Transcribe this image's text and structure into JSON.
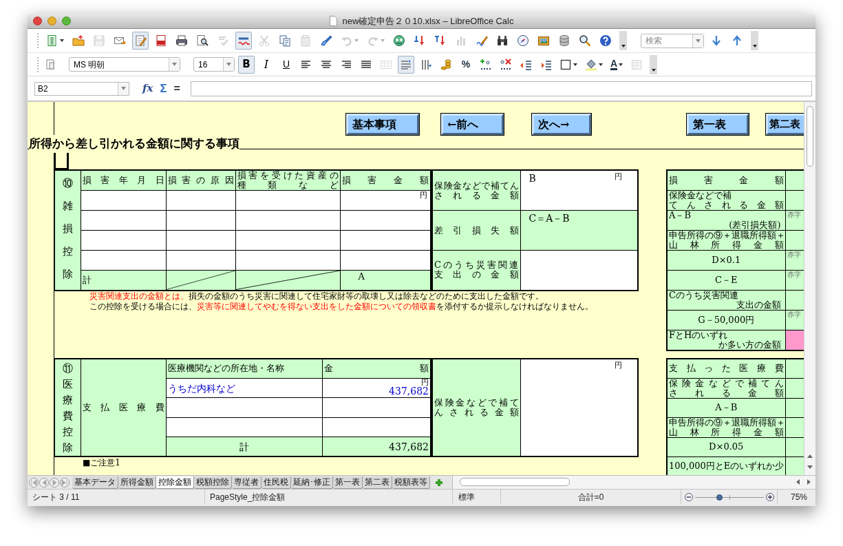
{
  "window": {
    "title": "new確定申告２０10.xlsx – LibreOffice Calc"
  },
  "toolbars": [
    {
      "items": [
        {
          "kind": "new",
          "pressed": false,
          "disabled": false
        },
        {
          "kind": "open",
          "pressed": false,
          "disabled": false
        },
        {
          "kind": "save",
          "pressed": false,
          "disabled": true
        },
        {
          "kind": "mail",
          "pressed": false,
          "disabled": false
        },
        {
          "kind": "edit",
          "pressed": true,
          "disabled": false
        },
        {
          "kind": "pdf",
          "pressed": false,
          "disabled": false
        },
        {
          "kind": "print",
          "pressed": false,
          "disabled": false
        },
        {
          "kind": "preview",
          "pressed": false,
          "disabled": false
        },
        {
          "kind": "spell",
          "pressed": false,
          "disabled": true
        },
        {
          "kind": "autospell",
          "pressed": true,
          "disabled": false
        },
        {
          "kind": "cut",
          "pressed": false,
          "disabled": true
        },
        {
          "kind": "copy",
          "pressed": false,
          "disabled": false
        },
        {
          "kind": "paste",
          "pressed": false,
          "disabled": true
        },
        {
          "kind": "clone",
          "pressed": false,
          "disabled": false
        },
        {
          "kind": "undo",
          "pressed": false,
          "disabled": true
        },
        {
          "kind": "redo",
          "pressed": false,
          "disabled": true
        },
        {
          "kind": "navigator",
          "pressed": false,
          "disabled": false
        },
        {
          "kind": "sort-asc",
          "pressed": false,
          "disabled": false
        },
        {
          "kind": "sort-desc",
          "pressed": false,
          "disabled": false
        },
        {
          "kind": "chart",
          "pressed": false,
          "disabled": true
        },
        {
          "kind": "draw",
          "pressed": false,
          "disabled": false
        },
        {
          "kind": "find",
          "pressed": false,
          "disabled": false
        },
        {
          "kind": "compass",
          "pressed": false,
          "disabled": false
        },
        {
          "kind": "gallery",
          "pressed": false,
          "disabled": false
        },
        {
          "kind": "database",
          "pressed": false,
          "disabled": false
        },
        {
          "kind": "zoom",
          "pressed": false,
          "disabled": false
        },
        {
          "kind": "help",
          "pressed": false,
          "disabled": false
        },
        {
          "kind": "more"
        },
        {
          "kind": "search-field",
          "placeholder": "検索"
        },
        {
          "kind": "down",
          "pressed": false,
          "disabled": false
        },
        {
          "kind": "up",
          "pressed": false,
          "disabled": false
        },
        {
          "kind": "more"
        }
      ]
    },
    {
      "items": [
        {
          "kind": "styles",
          "pressed": false,
          "disabled": false
        },
        {
          "kind": "font-name",
          "value": "MS 明朝"
        },
        {
          "kind": "font-size",
          "value": "16"
        },
        {
          "kind": "bold",
          "label": "B",
          "pressed": true,
          "disabled": false
        },
        {
          "kind": "italic",
          "label": "I",
          "pressed": false,
          "disabled": false
        },
        {
          "kind": "underline",
          "label": "U",
          "pressed": false,
          "disabled": false
        },
        {
          "kind": "align-left",
          "pressed": false,
          "disabled": false
        },
        {
          "kind": "align-center",
          "pressed": false,
          "disabled": false
        },
        {
          "kind": "align-right",
          "pressed": false,
          "disabled": false
        },
        {
          "kind": "justify",
          "pressed": false,
          "disabled": false
        },
        {
          "kind": "merge",
          "pressed": false,
          "disabled": true
        },
        {
          "kind": "wrap",
          "pressed": true,
          "disabled": false
        },
        {
          "kind": "vertical",
          "pressed": false,
          "disabled": false
        },
        {
          "kind": "currency",
          "pressed": false,
          "disabled": false
        },
        {
          "kind": "percent",
          "label": "%",
          "pressed": false,
          "disabled": false
        },
        {
          "kind": "add-decimal",
          "pressed": false,
          "disabled": false
        },
        {
          "kind": "del-decimal",
          "pressed": false,
          "disabled": false
        },
        {
          "kind": "outdent",
          "pressed": false,
          "disabled": false
        },
        {
          "kind": "indent",
          "pressed": false,
          "disabled": false
        },
        {
          "kind": "border",
          "pressed": false,
          "disabled": false
        },
        {
          "kind": "bg-color",
          "pressed": false,
          "disabled": false
        },
        {
          "kind": "font-color",
          "label": "A",
          "pressed": false,
          "disabled": false
        },
        {
          "kind": "grid",
          "pressed": false,
          "disabled": true
        },
        {
          "kind": "more"
        }
      ]
    }
  ],
  "formula_bar": {
    "cell_reference": "B2",
    "buttons": [
      "fx",
      "Σ",
      "="
    ]
  },
  "sheet": {
    "nav_buttons": [
      "基本事項",
      "←前へ",
      "次へ→",
      "第一表",
      "第二表"
    ],
    "heading": "所得から差し引かれる金額に関する事項",
    "casualty": {
      "label": "⑩雑損控除",
      "headers": [
        {
          "lines": [
            "損害年月日"
          ]
        },
        {
          "lines": [
            "損害の原因"
          ]
        },
        {
          "lines": [
            "損害を受けた資産の",
            "種類など"
          ]
        },
        {
          "lines": [
            "損害金額"
          ]
        }
      ],
      "entry_rows": [
        {
          "unit": "円"
        },
        {},
        {},
        {}
      ],
      "total_label": "計",
      "total_amount": "A",
      "side": [
        {
          "label_lines": [
            "保険金などで補てん",
            "される金額"
          ],
          "value": "B",
          "unit": "円",
          "shaded": false
        },
        {
          "label_lines": [
            "差引損失額"
          ],
          "value": "C＝A－B",
          "shaded": true
        },
        {
          "label_lines": [
            "Cのうち災害関連",
            "支出の金額"
          ],
          "shaded": false
        }
      ]
    },
    "notes": [
      [
        {
          "text": "災害関連支出の金額とは、",
          "red": true
        },
        {
          "text": "損失の金額のうち災害に関連して住宅家財等の取壊し又は除去などのために支出した金額です。",
          "red": false
        }
      ],
      [
        {
          "text": "この控除を受ける場合には、",
          "red": false
        },
        {
          "text": "災害等に関連してやむを得ない支出をした金額についての領収書",
          "red": true
        },
        {
          "text": "を添付するか提示しなければなりません。",
          "red": false
        }
      ]
    ],
    "casualty_calc": [
      {
        "lines": [
          "損害金額"
        ],
        "kind": "justify",
        "highlighted": false
      },
      {
        "lines": [
          "保険金などで補",
          "てんされる金額"
        ],
        "kind": "split",
        "highlighted": false
      },
      {
        "lines": [
          "A－B",
          "(差引損失額)"
        ],
        "kind": "stacked",
        "note": "赤字",
        "highlighted": false
      },
      {
        "lines": [
          "申告所得の⑨＋退職所得額＋",
          "山林所得金額"
        ],
        "kind": "justify",
        "highlighted": false
      },
      {
        "lines": [
          "D×0.1"
        ],
        "kind": "center",
        "note": "赤字",
        "highlighted": false
      },
      {
        "lines": [
          "C－E"
        ],
        "kind": "center",
        "note": "赤字",
        "highlighted": false
      },
      {
        "lines": [
          "Cのうち災害関連",
          "支出の金額"
        ],
        "kind": "stacked",
        "highlighted": false
      },
      {
        "lines": [
          "G－50,000円"
        ],
        "kind": "center",
        "note": "赤字",
        "highlighted": false
      },
      {
        "lines": [
          "FとHのいずれ",
          "か多い方の金額"
        ],
        "kind": "stacked",
        "highlighted": true
      }
    ],
    "medical": {
      "label": "⑪医療費控除",
      "sub_label": "支払医療費",
      "headers": [
        "医療機関などの所在地・名称",
        "金額"
      ],
      "entry_rows": [
        {
          "name": "うちだ内科など",
          "amount": "437,682",
          "unit": "円"
        },
        {},
        {}
      ],
      "total_label": "計",
      "total_amount": "437,682",
      "side": {
        "label_lines": [
          "保険金などで補て",
          "んされる金額"
        ],
        "unit": "円"
      }
    },
    "medical_calc": [
      {
        "lines": [
          "支払った医療費"
        ],
        "kind": "justify",
        "highlighted": false
      },
      {
        "lines": [
          "保険金などで補てん",
          "される金額"
        ],
        "kind": "justify",
        "highlighted": false
      },
      {
        "lines": [
          "A－B"
        ],
        "kind": "center",
        "highlighted": false
      },
      {
        "lines": [
          "申告所得の⑨＋退職所得額＋",
          "山林所得金額"
        ],
        "kind": "justify",
        "highlighted": false
      },
      {
        "lines": [
          "D×0.05"
        ],
        "kind": "center",
        "highlighted": false
      },
      {
        "lines": [
          "100,000円とEのいずれか少"
        ],
        "kind": "left",
        "highlighted": false
      }
    ],
    "caution": "■ご注意1"
  },
  "sheet_tabs": [
    {
      "label": "基本データ",
      "selected": false
    },
    {
      "label": "所得金額",
      "selected": false
    },
    {
      "label": "控除金額",
      "selected": true
    },
    {
      "label": "税額控除",
      "selected": false
    },
    {
      "label": "専従者",
      "selected": false
    },
    {
      "label": "住民税",
      "selected": false
    },
    {
      "label": "延納･修正",
      "selected": false
    },
    {
      "label": "第一表",
      "selected": false
    },
    {
      "label": "第二表",
      "selected": false
    },
    {
      "label": "税額表等",
      "selected": false
    }
  ],
  "status_bar": {
    "sheet": "シート 3 / 11",
    "page_style": "PageStyle_控除金額",
    "mode": "標準",
    "sum": "合計=0",
    "zoom": {
      "level": 0.35
    },
    "zoom_percent": "75%"
  }
}
